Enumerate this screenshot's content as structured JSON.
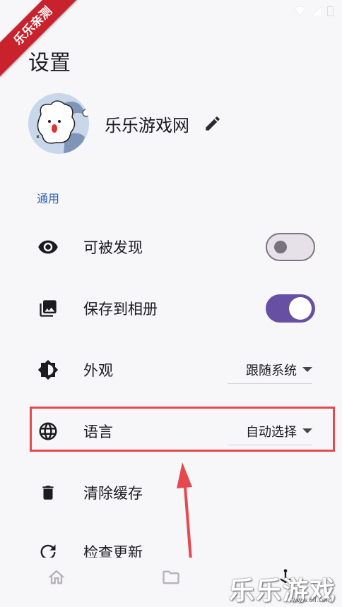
{
  "watermark": {
    "ribbon_text": "乐乐亲测",
    "brand_text": "乐乐游戏",
    "url_text": "www.6ll.com"
  },
  "header": {
    "title": "设置"
  },
  "profile": {
    "name": "乐乐游戏网"
  },
  "section": {
    "general_label": "通用"
  },
  "settings": {
    "discoverable": {
      "label": "可被发现",
      "enabled": false
    },
    "save_to_album": {
      "label": "保存到相册",
      "enabled": true
    },
    "appearance": {
      "label": "外观",
      "value": "跟随系统"
    },
    "language": {
      "label": "语言",
      "value": "自动选择"
    },
    "clear_cache": {
      "label": "清除缓存"
    },
    "check_update": {
      "label": "检查更新"
    }
  },
  "colors": {
    "accent": "#6750a4",
    "section_label": "#2e62b5",
    "highlight": "#e6494d"
  }
}
